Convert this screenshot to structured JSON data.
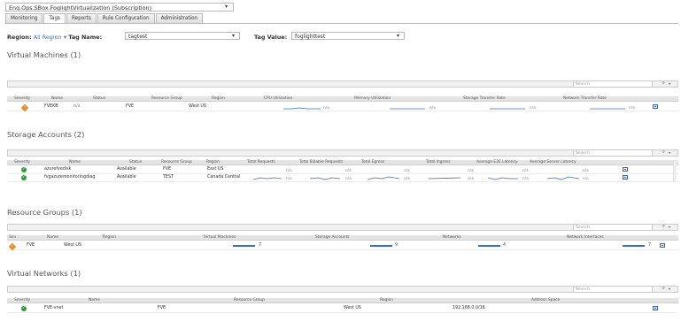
{
  "subscription": {
    "value": "Eng.Ops.SBox.FoglightVirtualization (Subscription)"
  },
  "tabs": [
    "Monitoring",
    "Tags",
    "Reports",
    "Rule Configuration",
    "Administration"
  ],
  "filters": {
    "region_label": "Region:",
    "region_value": "All Region",
    "tag_name_label": "Tag Name:",
    "tag_name_value": "tagtest",
    "tag_value_label": "Tag Value:",
    "tag_value_value": "foglighttest"
  },
  "search_placeholder": "Search",
  "vm": {
    "title": "Virtual Machines (1)",
    "headers": [
      "Severity",
      "Name",
      "Status",
      "Resource Group",
      "Region",
      "CPU Utilization",
      "Memory Utilization",
      "Storage Transfer Rate",
      "Network Transfer Rate"
    ],
    "rows": [
      {
        "name": "FVEKB",
        "status": "n/a",
        "group": "FVE",
        "region": "West US",
        "cpu": "n/a",
        "mem": "n/a",
        "storage": "n/a",
        "network": "n/a"
      }
    ]
  },
  "storage": {
    "title": "Storage Accounts (2)",
    "headers": [
      "Severity",
      "Name",
      "Status",
      "Resource Group",
      "Region",
      "Total Requests",
      "Total Billable Requests",
      "Total Egress",
      "Total Ingress",
      "Average E2E Latency",
      "Average Server Latency"
    ],
    "rows": [
      {
        "name": "azurefvedisk",
        "status": "Available",
        "group": "FVE",
        "region": "East US",
        "v": [
          "n/a",
          "n/a",
          "n/a",
          "n/a",
          "n/a",
          "n/a"
        ]
      },
      {
        "name": "fvgazuremonitoringdiag",
        "status": "Available",
        "group": "TEST",
        "region": "Canada Central",
        "v": [
          "n/a",
          "n/a",
          "n/a",
          "n/a",
          "n/a",
          "n/a"
        ]
      }
    ]
  },
  "rg": {
    "title": "Resource Groups (1)",
    "headers": [
      "Sev",
      "Name",
      "Region",
      "Virtual Machines",
      "Storage Accounts",
      "Networks",
      "Network Interfaces"
    ],
    "rows": [
      {
        "name": "FVE",
        "region": "West US",
        "vms": "7",
        "sa": "9",
        "nets": "4",
        "nics": "7"
      }
    ]
  },
  "vnet": {
    "title": "Virtual Networks (1)",
    "headers": [
      "Severity",
      "Name",
      "Resource Group",
      "Region",
      "Address Space"
    ],
    "rows": [
      {
        "name": "FVE-vnet",
        "group": "FVE",
        "region": "West US",
        "address": "192.168.0.0/16"
      }
    ]
  },
  "colors": {
    "ok": "#2e9a3b",
    "warn": "#e98b2a",
    "bar": "#3a6fb8"
  }
}
